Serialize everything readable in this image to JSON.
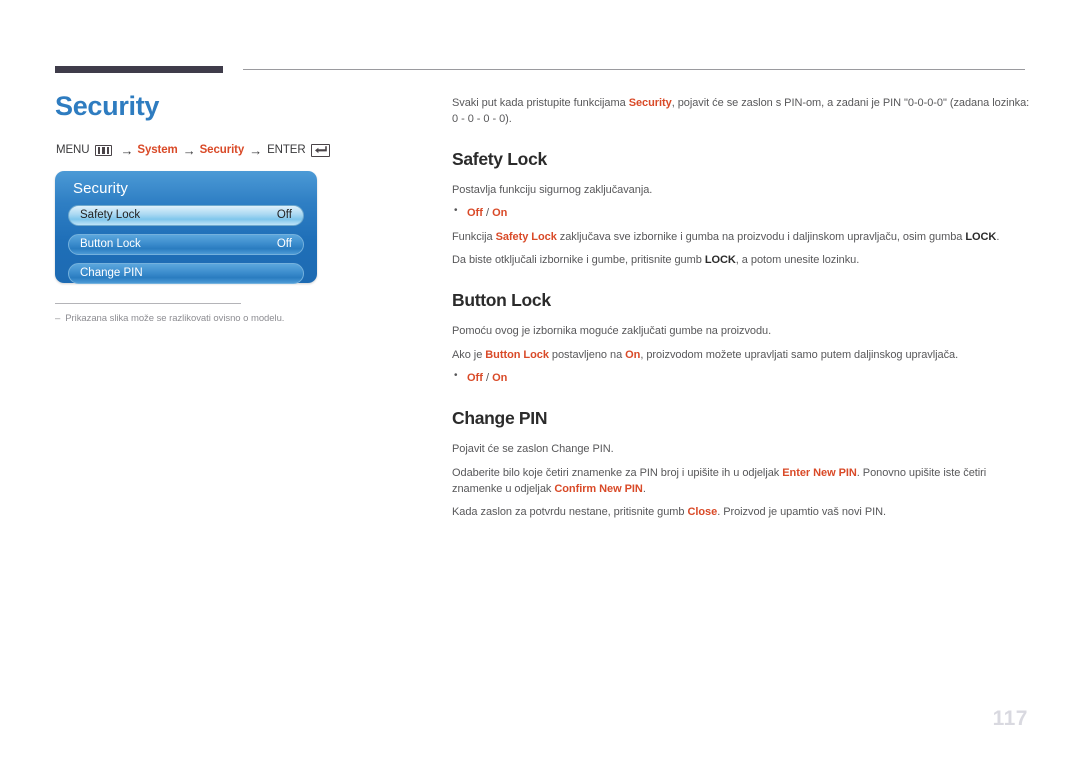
{
  "page": {
    "title": "Security",
    "number": "117",
    "title_color": "#2e7cc0",
    "accent_color": "#d94a28"
  },
  "menu_path": {
    "menu_label": "MENU",
    "menu_icon": "menu-bars-icon",
    "arrow": "→",
    "step1": "System",
    "step2": "Security",
    "enter_label": "ENTER",
    "enter_icon": "enter-key-icon"
  },
  "osd": {
    "title": "Security",
    "rows": [
      {
        "label": "Safety Lock",
        "value": "Off",
        "selected": true
      },
      {
        "label": "Button Lock",
        "value": "Off",
        "selected": false
      },
      {
        "label": "Change PIN",
        "value": "",
        "selected": false
      }
    ]
  },
  "footnote": {
    "dash": "–",
    "text": "Prikazana slika može se razlikovati ovisno o modelu."
  },
  "content": {
    "lead": {
      "part1": "Svaki put kada pristupite funkcijama ",
      "hl1": "Security",
      "part2": ", pojavit će se zaslon s PIN-om, a zadani je PIN \"0-0-0-0\" (zadana lozinka: 0 - 0 - 0 - 0)."
    },
    "sections": [
      {
        "heading": "Safety Lock",
        "line1": "Postavlja funkciju sigurnog zaključavanja.",
        "bullet_off": "Off",
        "bullet_sep": " / ",
        "bullet_on": "On",
        "line2_a": "Funkcija ",
        "line2_hl": "Safety Lock",
        "line2_b": " zaključava sve izbornike i gumba na proizvodu i daljinskom upravljaču, osim gumba ",
        "line2_bold": "LOCK",
        "line2_c": ".",
        "line3_a": "Da biste otključali izbornike i gumbe, pritisnite gumb ",
        "line3_bold": "LOCK",
        "line3_b": ", a potom unesite lozinku."
      },
      {
        "heading": "Button Lock",
        "line1": "Pomoću ovog je izbornika moguće zaključati gumbe na proizvodu.",
        "line2_a": "Ako je ",
        "line2_hl1": "Button Lock",
        "line2_b": " postavljeno na ",
        "line2_hl2": "On",
        "line2_c": ", proizvodom možete upravljati samo putem daljinskog upravljača.",
        "bullet_off": "Off",
        "bullet_sep": " / ",
        "bullet_on": "On"
      },
      {
        "heading": "Change PIN",
        "line1": "Pojavit će se zaslon Change PIN.",
        "line2_a": "Odaberite bilo koje četiri znamenke za PIN broj i upišite ih u odjeljak ",
        "line2_hl1": "Enter New PIN",
        "line2_b": ". Ponovno upišite iste četiri znamenke u odjeljak ",
        "line2_hl2": "Confirm New PIN",
        "line2_c": ".",
        "line3_a": "Kada zaslon za potvrdu nestane, pritisnite gumb ",
        "line3_hl": "Close",
        "line3_b": ". Proizvod je upamtio vaš novi PIN."
      }
    ]
  }
}
